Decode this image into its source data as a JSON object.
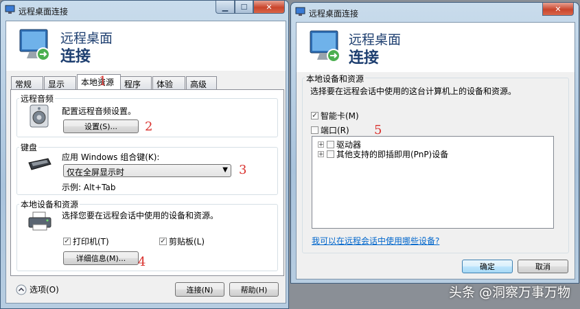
{
  "windowA": {
    "title": "远程桌面连接",
    "banner_line1": "远程桌面",
    "banner_line2": "连接",
    "tabs": [
      "常规",
      "显示",
      "本地资源",
      "程序",
      "体验",
      "高级"
    ],
    "audio": {
      "label": "远程音频",
      "desc": "配置远程音频设置。",
      "button": "设置(S)..."
    },
    "keyboard": {
      "label": "键盘",
      "desc": "应用 Windows 组合键(K):",
      "selected": "仅在全屏显示时",
      "example": "示例: Alt+Tab"
    },
    "devices": {
      "label": "本地设备和资源",
      "desc": "选择您要在远程会话中使用的设备和资源。",
      "printer": "打印机(T)",
      "clipboard": "剪贴板(L)",
      "details_button": "详细信息(M)..."
    },
    "options_label": "选项(O)",
    "connect_button": "连接(N)",
    "help_button": "帮助(H)"
  },
  "windowB": {
    "title": "远程桌面连接",
    "banner_line1": "远程桌面",
    "banner_line2": "连接",
    "group_label": "本地设备和资源",
    "desc": "选择要在远程会话中使用的这台计算机上的设备和资源。",
    "smartcard": "智能卡(M)",
    "port": "端口(R)",
    "tree_items": [
      "驱动器",
      "其他支持的即插即用(PnP)设备"
    ],
    "link": "我可以在远程会话中使用哪些设备?",
    "ok_button": "确定",
    "cancel_button": "取消"
  },
  "annotations": {
    "n1": "1",
    "n2": "2",
    "n3": "3",
    "n4": "4",
    "n5": "5"
  },
  "watermark": "头条 @洞察万事万物",
  "icons": [
    "rdp-monitor-icon",
    "speaker-icon",
    "keyboard-icon",
    "printer-icon",
    "expand-icon",
    "close-icon",
    "minimize-icon",
    "maximize-icon"
  ]
}
